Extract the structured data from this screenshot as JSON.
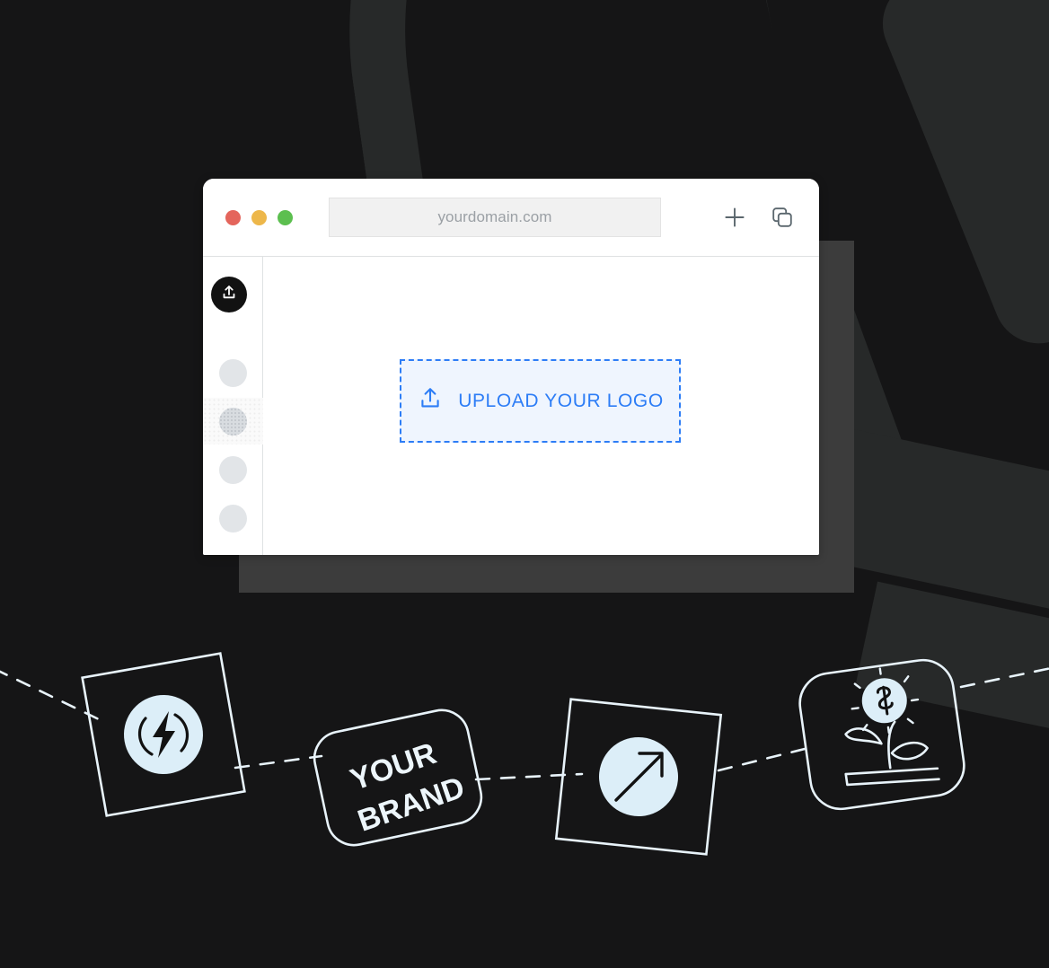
{
  "background": {
    "page_color": "#151516",
    "shape_color": "#272929",
    "panel_color": "#3C3C3C"
  },
  "browser": {
    "traffic_lights": [
      {
        "name": "close",
        "color": "#E4655C"
      },
      {
        "name": "minimize",
        "color": "#EDB74A"
      },
      {
        "name": "maximize",
        "color": "#5CBF4F"
      }
    ],
    "address_bar": {
      "value": "yourdomain.com",
      "placeholder": "yourdomain.com"
    },
    "actions": [
      {
        "name": "new-tab",
        "icon": "plus-icon"
      },
      {
        "name": "duplicate-tab",
        "icon": "copy-icon"
      }
    ]
  },
  "sidebar": {
    "upload_button": {
      "icon": "upload-icon",
      "label": ""
    },
    "items": [
      {
        "name": "sidebar-item-1",
        "selected": false
      },
      {
        "name": "sidebar-item-2",
        "selected": true
      },
      {
        "name": "sidebar-item-3",
        "selected": false
      },
      {
        "name": "sidebar-item-4",
        "selected": false
      }
    ]
  },
  "dropzone": {
    "icon": "upload-icon",
    "label": "UPLOAD YOUR LOGO",
    "accent_color": "#2D7DF6",
    "fill_color": "#EFF5FE"
  },
  "journey": {
    "accent": "#DCEEF8",
    "cards": [
      {
        "name": "energy-card",
        "icon": "lightning-bolt-icon",
        "label": ""
      },
      {
        "name": "brand-card",
        "icon": "",
        "label_line1": "YOUR",
        "label_line2": "BRAND"
      },
      {
        "name": "growth-card",
        "icon": "arrow-up-right-icon",
        "label": ""
      },
      {
        "name": "revenue-card",
        "icon": "money-plant-icon",
        "label": ""
      }
    ]
  }
}
